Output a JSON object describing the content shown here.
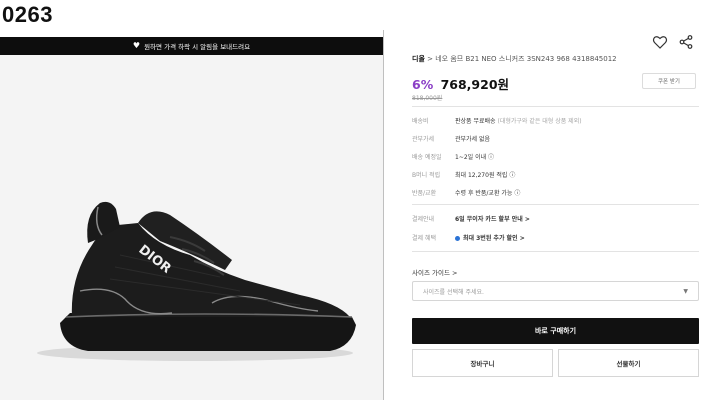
{
  "frame_label": "0263",
  "notice_bar": {
    "icon": "heart-icon",
    "text": "원하면 가격 하락 시 알림을 보내드려요"
  },
  "product_image": {
    "subject": "black knit sneaker",
    "brand_letters": "DIOR"
  },
  "header_icons": [
    "heart-outline-icon",
    "share-icon"
  ],
  "product": {
    "brand": "디올",
    "breadcrumb_sep": ">",
    "name": "네오 옴므 B21 NEO 스니커즈 3SN243 968 4318845012",
    "discount": "6%",
    "price": "768,920원",
    "original_price": "818,000원",
    "coupon_label": "쿠폰 받기"
  },
  "info_rows": [
    {
      "label": "배송비",
      "value": "판상품 무료배송",
      "note": "(대형가구와 같은 대형 상품 제외)"
    },
    {
      "label": "관부가세",
      "value": "관부가세 없음",
      "note": ""
    },
    {
      "label": "배송 예정일",
      "value": "1~2일 이내 ⓘ",
      "note": ""
    },
    {
      "label": "B머니 적립",
      "value": "최대 12,270원 적립 ⓘ",
      "note": ""
    },
    {
      "label": "반품/교환",
      "value": "수령 후 반품/교환 가능 ⓘ",
      "note": ""
    }
  ],
  "payment_rows": [
    {
      "label": "결제안내",
      "value": "6일 무이자 카드 할부 안내 >"
    },
    {
      "label": "결제 혜택",
      "value": "최대 3번된 추가 할인 >"
    }
  ],
  "size": {
    "guide_label": "사이즈 가이드 >",
    "select_placeholder": "사이즈를 선택해 주세요.",
    "select_arrow": "▼"
  },
  "buttons": {
    "buy_now": "바로 구매하기",
    "cart": "장바구니",
    "gift": "선물하기"
  },
  "colors": {
    "accent_discount": "#8b3fc6",
    "buy_button": "#111111",
    "notice_bar": "#0d0d0d"
  }
}
